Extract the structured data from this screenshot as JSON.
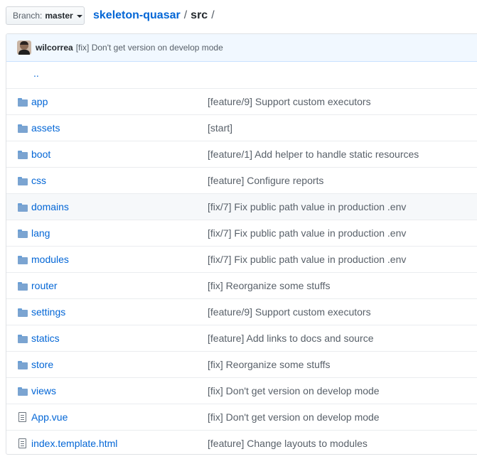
{
  "branch": {
    "label": "Branch:",
    "value": "master"
  },
  "breadcrumb": {
    "repo": "skeleton-quasar",
    "dir": "src",
    "sep": "/"
  },
  "commit": {
    "author": "wilcorrea",
    "message": "[fix] Don't get version on develop mode"
  },
  "up_link": "..",
  "files": [
    {
      "name": "app",
      "type": "folder",
      "message": "[feature/9] Support custom executors"
    },
    {
      "name": "assets",
      "type": "folder",
      "message": "[start]"
    },
    {
      "name": "boot",
      "type": "folder",
      "message": "[feature/1] Add helper to handle static resources"
    },
    {
      "name": "css",
      "type": "folder",
      "message": "[feature] Configure reports"
    },
    {
      "name": "domains",
      "type": "folder",
      "message": "[fix/7] Fix public path value in production .env"
    },
    {
      "name": "lang",
      "type": "folder",
      "message": "[fix/7] Fix public path value in production .env"
    },
    {
      "name": "modules",
      "type": "folder",
      "message": "[fix/7] Fix public path value in production .env"
    },
    {
      "name": "router",
      "type": "folder",
      "message": "[fix] Reorganize some stuffs"
    },
    {
      "name": "settings",
      "type": "folder",
      "message": "[feature/9] Support custom executors"
    },
    {
      "name": "statics",
      "type": "folder",
      "message": "[feature] Add links to docs and source"
    },
    {
      "name": "store",
      "type": "folder",
      "message": "[fix] Reorganize some stuffs"
    },
    {
      "name": "views",
      "type": "folder",
      "message": "[fix] Don't get version on develop mode"
    },
    {
      "name": "App.vue",
      "type": "file",
      "message": "[fix] Don't get version on develop mode"
    },
    {
      "name": "index.template.html",
      "type": "file",
      "message": "[feature] Change layouts to modules"
    }
  ]
}
